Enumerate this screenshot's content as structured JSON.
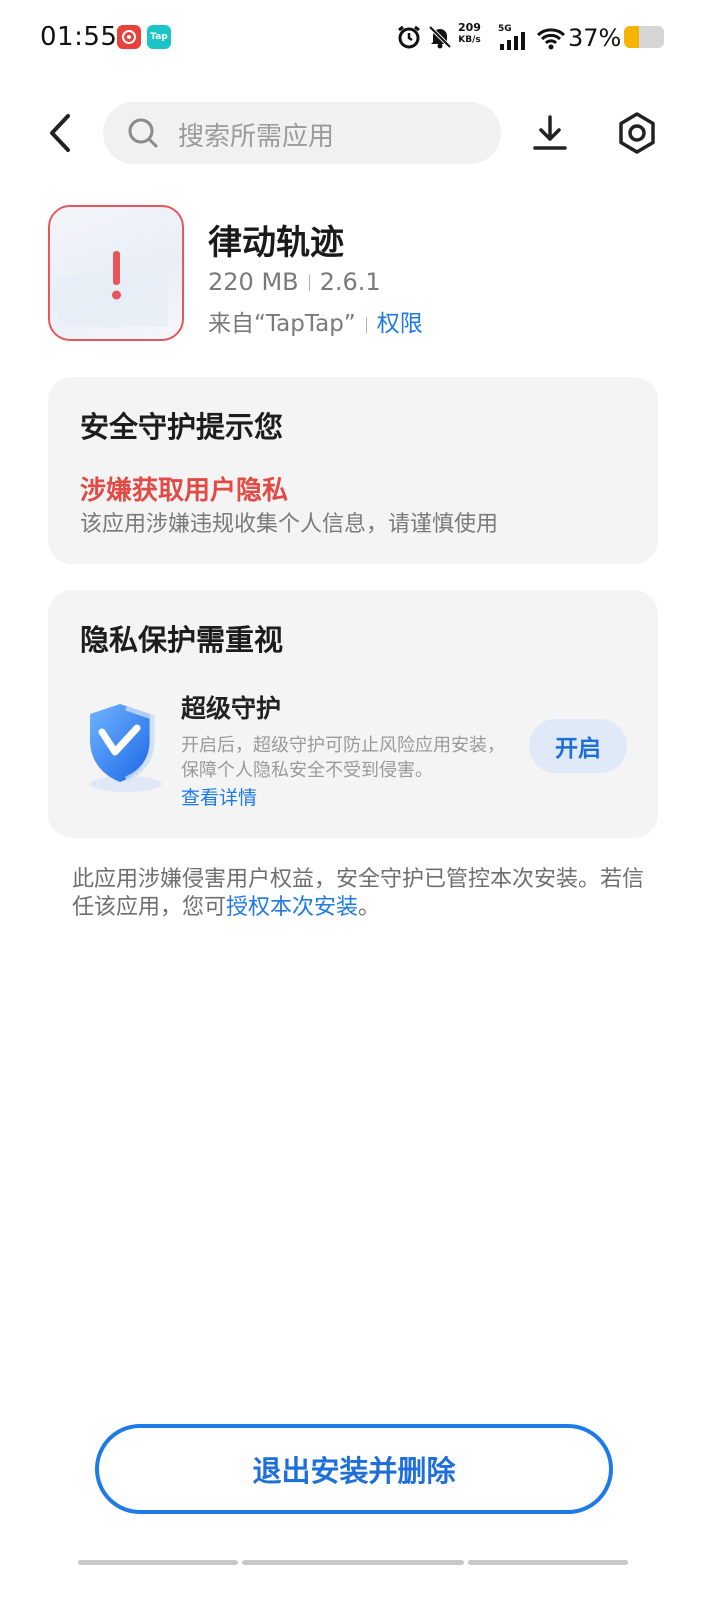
{
  "status_bar": {
    "time": "01:55",
    "notif_icons": [
      {
        "name": "netease-music-icon",
        "color": "#e8413a"
      },
      {
        "name": "taptap-icon",
        "label": "Tap",
        "color": "#1bc5c7"
      }
    ],
    "net_speed_value": "209",
    "net_speed_unit": "KB/s",
    "network_type": "5G",
    "battery_percent": "37%",
    "battery_level": 0.37,
    "battery_color": "#f4b400"
  },
  "search": {
    "placeholder": "搜索所需应用"
  },
  "app": {
    "name": "律动轨迹",
    "size": "220 MB",
    "version": "2.6.1",
    "source": "来自“TapTap”",
    "permissions_link": "权限"
  },
  "security_card": {
    "title": "安全守护提示您",
    "warning_title": "涉嫌获取用户隐私",
    "warning_desc": "该应用涉嫌违规收集个人信息，请谨慎使用"
  },
  "privacy_card": {
    "title": "隐私保护需重视",
    "feature_title": "超级守护",
    "feature_desc": "开启后，超级守护可防止风险应用安装，保障个人隐私安全不受到侵害。",
    "details_link": "查看详情",
    "enable_button": "开启"
  },
  "notice": {
    "text": "此应用涉嫌侵害用户权益，安全守护已管控本次安装。若信任该应用，您可",
    "link": "授权本次安装",
    "end": "。"
  },
  "exit_button": "退出安装并删除",
  "colors": {
    "accent": "#1e7ae8",
    "danger": "#e24a46",
    "card_bg": "#f4f4f5"
  }
}
